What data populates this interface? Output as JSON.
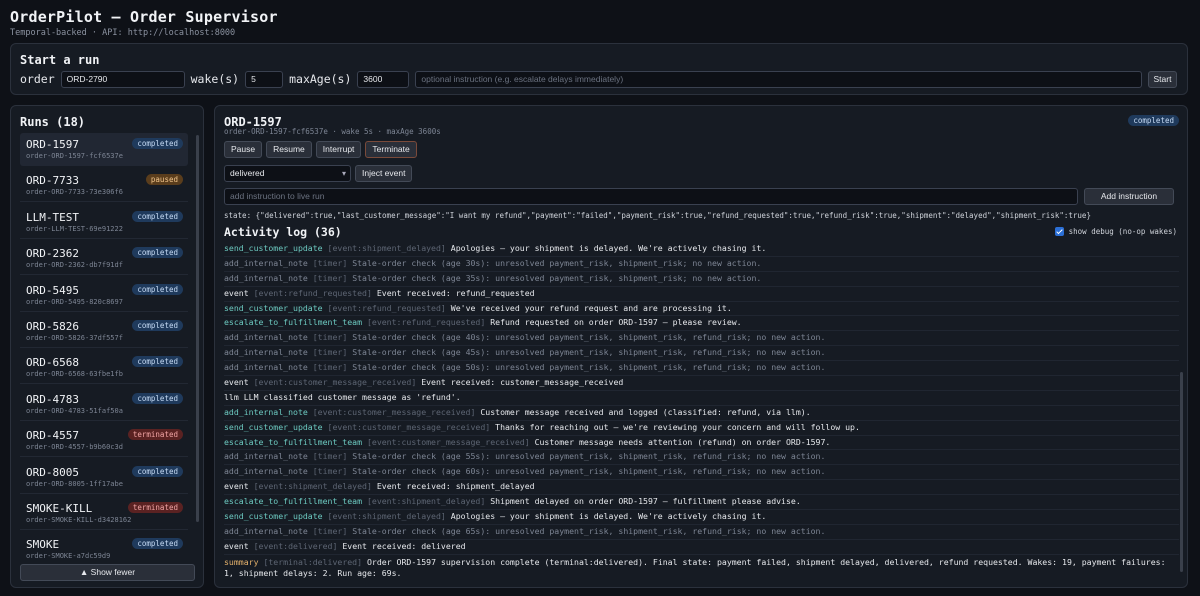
{
  "app": {
    "title": "OrderPilot — Order Supervisor",
    "subtitle": "Temporal-backed · API: http://localhost:8000"
  },
  "start_run": {
    "title": "Start a run",
    "order_label": "order",
    "order_value": "ORD-2790",
    "wake_label": "wake(s)",
    "wake_value": "5",
    "maxage_label": "maxAge(s)",
    "maxage_value": "3600",
    "instruction_placeholder": "optional instruction (e.g. escalate delays immediately)",
    "start_label": "Start"
  },
  "runs": {
    "title": "Runs (18)",
    "show_fewer_label": "▲ Show fewer",
    "items": [
      {
        "name": "ORD-1597",
        "id": "order-ORD-1597-fcf6537e",
        "status": "completed"
      },
      {
        "name": "ORD-7733",
        "id": "order-ORD-7733-73e306f6",
        "status": "paused"
      },
      {
        "name": "LLM-TEST",
        "id": "order-LLM-TEST-69e91222",
        "status": "completed"
      },
      {
        "name": "ORD-2362",
        "id": "order-ORD-2362-db7f91df",
        "status": "completed"
      },
      {
        "name": "ORD-5495",
        "id": "order-ORD-5495-820c8697",
        "status": "completed"
      },
      {
        "name": "ORD-5826",
        "id": "order-ORD-5826-37df557f",
        "status": "completed"
      },
      {
        "name": "ORD-6568",
        "id": "order-ORD-6568-63fbe1fb",
        "status": "completed"
      },
      {
        "name": "ORD-4783",
        "id": "order-ORD-4783-51faf50a",
        "status": "completed"
      },
      {
        "name": "ORD-4557",
        "id": "order-ORD-4557-b9b60c3d",
        "status": "terminated"
      },
      {
        "name": "ORD-8005",
        "id": "order-ORD-8005-1ff17abe",
        "status": "completed"
      },
      {
        "name": "SMOKE-KILL",
        "id": "order-SMOKE-KILL-d3428162",
        "status": "terminated"
      },
      {
        "name": "SMOKE",
        "id": "order-SMOKE-a7dc59d9",
        "status": "completed"
      }
    ]
  },
  "detail": {
    "title": "ORD-1597",
    "subtitle": "order-ORD-1597-fcf6537e · wake 5s · maxAge 3600s",
    "status": "completed",
    "buttons": {
      "pause": "Pause",
      "resume": "Resume",
      "interrupt": "Interrupt",
      "terminate": "Terminate"
    },
    "event_select_value": "delivered",
    "inject_label": "Inject event",
    "instruction_placeholder": "add instruction to live run",
    "add_instruction_label": "Add instruction",
    "state_line": "state: {\"delivered\":true,\"last_customer_message\":\"I want my refund\",\"payment\":\"failed\",\"payment_risk\":true,\"refund_requested\":true,\"refund_risk\":true,\"shipment\":\"delayed\",\"shipment_risk\":true}",
    "log_title": "Activity log (36)",
    "show_debug_label": "show debug (no-op wakes)",
    "show_debug_checked": true
  },
  "log": [
    {
      "kind": "action",
      "name": "send_customer_update",
      "ctx": "[event:shipment_delayed]",
      "msg": "Apologies — your shipment is delayed. We're actively chasing it."
    },
    {
      "kind": "debug",
      "name": "add_internal_note",
      "ctx": "[timer]",
      "msg": "Stale-order check (age 30s): unresolved payment_risk, shipment_risk; no new action."
    },
    {
      "kind": "debug",
      "name": "add_internal_note",
      "ctx": "[timer]",
      "msg": "Stale-order check (age 35s): unresolved payment_risk, shipment_risk; no new action."
    },
    {
      "kind": "event",
      "name": "event",
      "ctx": "[event:refund_requested]",
      "msg": "Event received: refund_requested"
    },
    {
      "kind": "action",
      "name": "send_customer_update",
      "ctx": "[event:refund_requested]",
      "msg": "We've received your refund request and are processing it."
    },
    {
      "kind": "action",
      "name": "escalate_to_fulfillment_team",
      "ctx": "[event:refund_requested]",
      "msg": "Refund requested on order ORD-1597 — please review."
    },
    {
      "kind": "debug",
      "name": "add_internal_note",
      "ctx": "[timer]",
      "msg": "Stale-order check (age 40s): unresolved payment_risk, shipment_risk, refund_risk; no new action."
    },
    {
      "kind": "debug",
      "name": "add_internal_note",
      "ctx": "[timer]",
      "msg": "Stale-order check (age 45s): unresolved payment_risk, shipment_risk, refund_risk; no new action."
    },
    {
      "kind": "debug",
      "name": "add_internal_note",
      "ctx": "[timer]",
      "msg": "Stale-order check (age 50s): unresolved payment_risk, shipment_risk, refund_risk; no new action."
    },
    {
      "kind": "event",
      "name": "event",
      "ctx": "[event:customer_message_received]",
      "msg": "Event received: customer_message_received"
    },
    {
      "kind": "event",
      "name": "llm",
      "ctx": "",
      "msg": "LLM classified customer message as 'refund'."
    },
    {
      "kind": "action",
      "name": "add_internal_note",
      "ctx": "[event:customer_message_received]",
      "msg": "Customer message received and logged (classified: refund, via llm)."
    },
    {
      "kind": "action",
      "name": "send_customer_update",
      "ctx": "[event:customer_message_received]",
      "msg": "Thanks for reaching out — we're reviewing your concern and will follow up."
    },
    {
      "kind": "action",
      "name": "escalate_to_fulfillment_team",
      "ctx": "[event:customer_message_received]",
      "msg": "Customer message needs attention (refund) on order ORD-1597."
    },
    {
      "kind": "debug",
      "name": "add_internal_note",
      "ctx": "[timer]",
      "msg": "Stale-order check (age 55s): unresolved payment_risk, shipment_risk, refund_risk; no new action."
    },
    {
      "kind": "debug",
      "name": "add_internal_note",
      "ctx": "[timer]",
      "msg": "Stale-order check (age 60s): unresolved payment_risk, shipment_risk, refund_risk; no new action."
    },
    {
      "kind": "event",
      "name": "event",
      "ctx": "[event:shipment_delayed]",
      "msg": "Event received: shipment_delayed"
    },
    {
      "kind": "action",
      "name": "escalate_to_fulfillment_team",
      "ctx": "[event:shipment_delayed]",
      "msg": "Shipment delayed on order ORD-1597 — fulfillment please advise."
    },
    {
      "kind": "action",
      "name": "send_customer_update",
      "ctx": "[event:shipment_delayed]",
      "msg": "Apologies — your shipment is delayed. We're actively chasing it."
    },
    {
      "kind": "debug",
      "name": "add_internal_note",
      "ctx": "[timer]",
      "msg": "Stale-order check (age 65s): unresolved payment_risk, shipment_risk, refund_risk; no new action."
    },
    {
      "kind": "event",
      "name": "event",
      "ctx": "[event:delivered]",
      "msg": "Event received: delivered"
    },
    {
      "kind": "summary",
      "name": "summary",
      "ctx": "[terminal:delivered]",
      "msg": "Order ORD-1597 supervision complete (terminal:delivered). Final state: payment failed, shipment delayed, delivered, refund requested. Wakes: 19, payment failures: 1, shipment delays: 2. Run age: 69s."
    }
  ],
  "colors": {
    "completed": "#1f3a5c",
    "paused": "#5a3d1c",
    "terminated": "#5a2222",
    "action": "#6cc9c0",
    "summary": "#e3b06b"
  }
}
